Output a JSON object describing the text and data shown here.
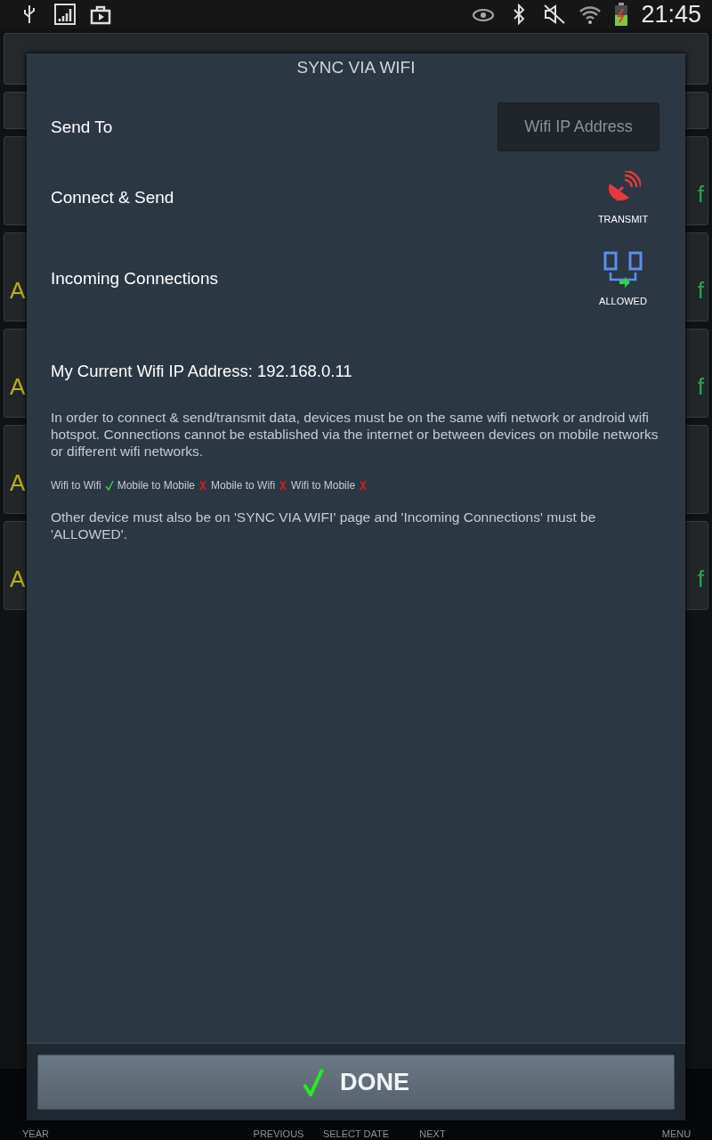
{
  "status_bar": {
    "time": "21:45"
  },
  "background_rows": [
    {
      "left": "",
      "right": "f"
    },
    {
      "left": "A",
      "right": "f"
    },
    {
      "left": "A",
      "right": "f"
    },
    {
      "left": "A",
      "right": ""
    },
    {
      "left": "A",
      "right": "f"
    }
  ],
  "bottom_nav": [
    {
      "label": "YEAR"
    },
    {
      "label": "PREVIOUS"
    },
    {
      "label": "SELECT DATE"
    },
    {
      "label": "NEXT"
    },
    {
      "label": "MENU"
    }
  ],
  "dialog": {
    "title": "SYNC VIA WIFI",
    "send_to": {
      "label": "Send To",
      "placeholder": "Wifi IP Address"
    },
    "connect": {
      "label": "Connect & Send",
      "action": "TRANSMIT"
    },
    "incoming": {
      "label": "Incoming Connections",
      "status": "ALLOWED"
    },
    "my_ip": "My Current Wifi IP Address: 192.168.0.11",
    "info": "In order to connect & send/transmit data, devices must be on the same wifi network or android wifi hotspot. Connections cannot be established via the internet or between devices on mobile networks or different wifi networks.",
    "compatibility": [
      {
        "label": "Wifi to Wifi",
        "supported": true
      },
      {
        "label": "Mobile to Mobile",
        "supported": false
      },
      {
        "label": "Mobile to Wifi",
        "supported": false
      },
      {
        "label": "Wifi to Mobile",
        "supported": false
      }
    ],
    "note": "Other device must also be on 'SYNC VIA WIFI' page and 'Incoming Connections' must be 'ALLOWED'.",
    "done_button": "DONE"
  }
}
